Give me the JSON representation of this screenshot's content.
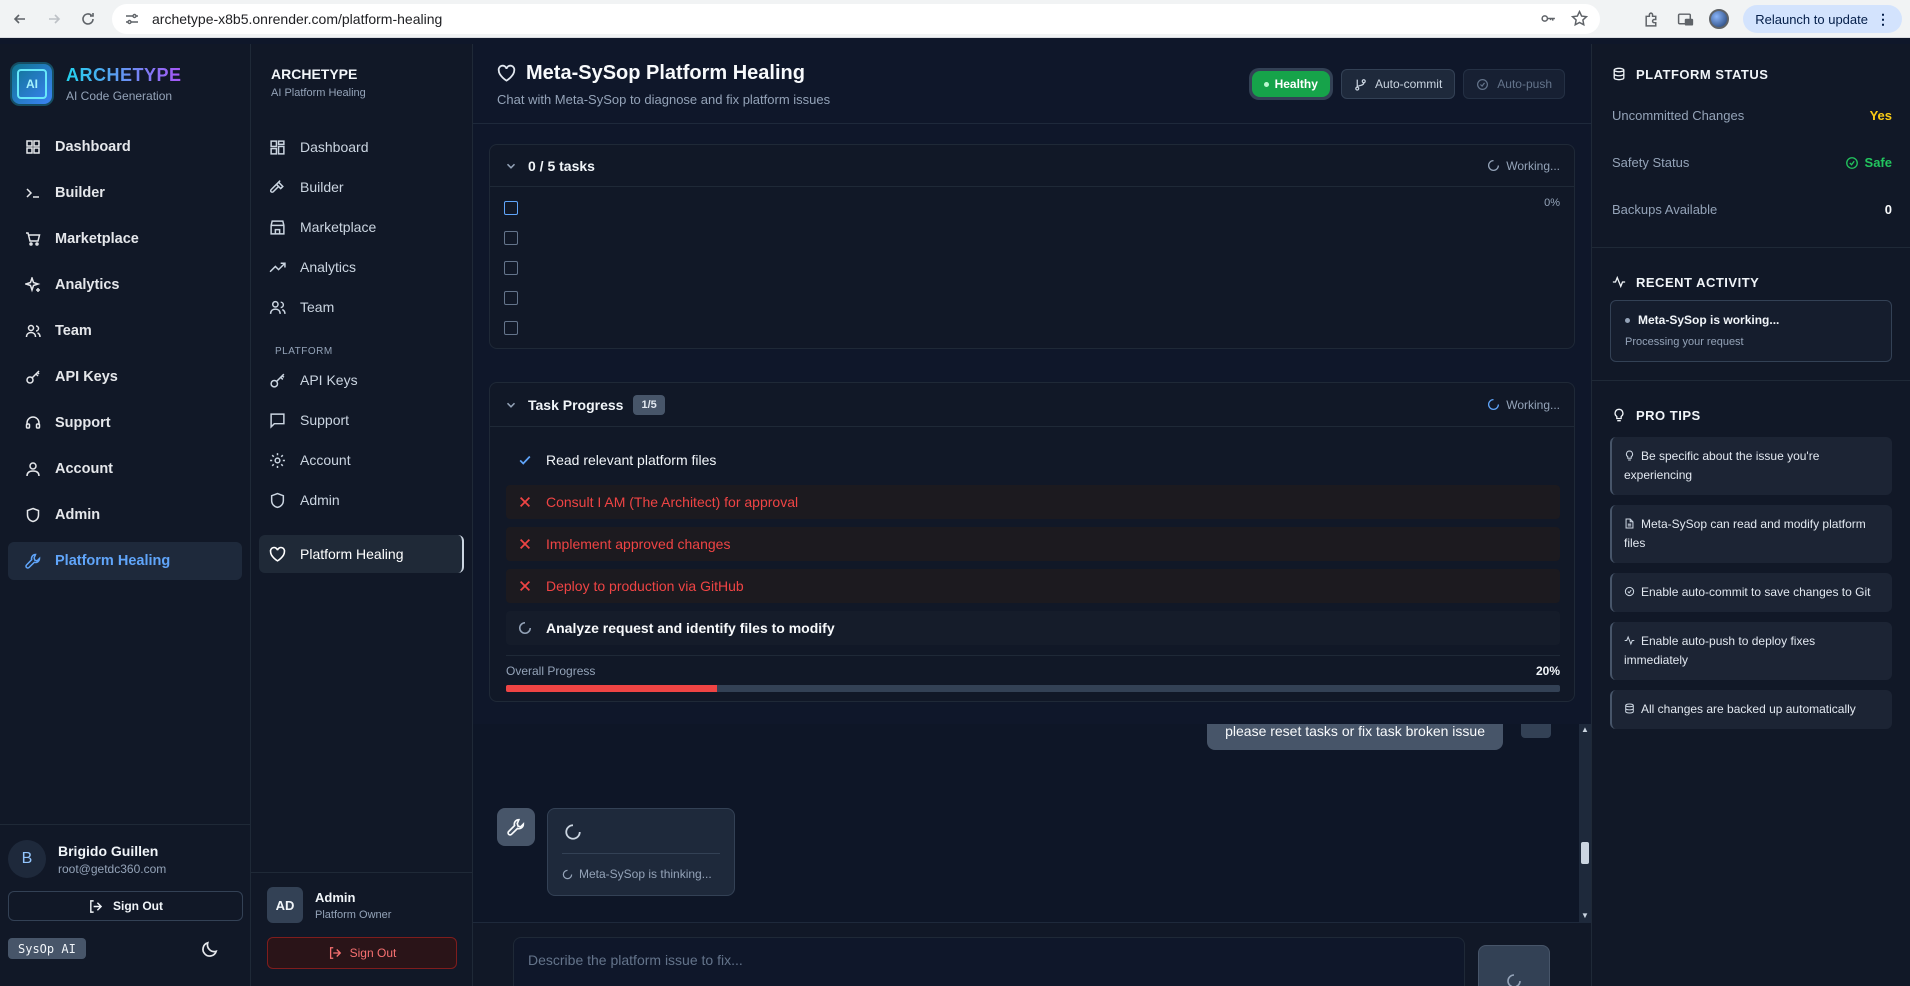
{
  "browser": {
    "url": "archetype-x8b5.onrender.com/platform-healing",
    "relaunch_label": "Relaunch to update"
  },
  "sidebar1": {
    "brand_title": "ARCHETYPE",
    "brand_sub": "AI Code Generation",
    "logo_text": "AI",
    "items": [
      {
        "label": "Dashboard",
        "icon": "grid-icon"
      },
      {
        "label": "Builder",
        "icon": "terminal-icon"
      },
      {
        "label": "Marketplace",
        "icon": "cart-icon"
      },
      {
        "label": "Analytics",
        "icon": "sparkle-icon"
      },
      {
        "label": "Team",
        "icon": "users-icon"
      },
      {
        "label": "API Keys",
        "icon": "key-icon"
      },
      {
        "label": "Support",
        "icon": "headset-icon"
      },
      {
        "label": "Account",
        "icon": "user-icon"
      },
      {
        "label": "Admin",
        "icon": "shield-icon"
      },
      {
        "label": "Platform Healing",
        "icon": "wrench-icon"
      }
    ],
    "user_initial": "B",
    "user_name": "Brigido Guillen",
    "user_email": "root@getdc360.com",
    "signout_label": "Sign Out",
    "sysop_badge": "SysOp AI"
  },
  "sidebar2": {
    "title": "ARCHETYPE",
    "subtitle": "AI Platform Healing",
    "items": [
      {
        "label": "Dashboard"
      },
      {
        "label": "Builder"
      },
      {
        "label": "Marketplace"
      },
      {
        "label": "Analytics"
      },
      {
        "label": "Team"
      }
    ],
    "section_label": "PLATFORM",
    "platform_items": [
      {
        "label": "API Keys"
      },
      {
        "label": "Support"
      },
      {
        "label": "Account"
      },
      {
        "label": "Admin"
      }
    ],
    "active_label": "Platform Healing",
    "user_initials": "AD",
    "user_name": "Admin",
    "user_role": "Platform Owner",
    "signout_label": "Sign Out"
  },
  "header": {
    "title": "Meta-SySop Platform Healing",
    "subtitle": "Chat with Meta-SySop to diagnose and fix platform issues",
    "healthy_label": "Healthy",
    "autocommit_label": "Auto-commit",
    "autopush_label": "Auto-push",
    "colors": {
      "healthy": "#16a34a"
    }
  },
  "tasks_card": {
    "title": "0 / 5 tasks",
    "status": "Working...",
    "percent_label": "0%",
    "checkbox_count": 5
  },
  "progress_card": {
    "title": "Task Progress",
    "badge": "1/5",
    "status": "Working...",
    "tasks": [
      {
        "label": "Read relevant platform files",
        "state": "done"
      },
      {
        "label": "Consult I AM (The Architect) for approval",
        "state": "failed"
      },
      {
        "label": "Implement approved changes",
        "state": "failed"
      },
      {
        "label": "Deploy to production via GitHub",
        "state": "failed"
      },
      {
        "label": "Analyze request and identify files to modify",
        "state": "running"
      }
    ],
    "overall_label": "Overall Progress",
    "overall_percent": "20%",
    "overall_fraction": 0.2,
    "colors": {
      "progress": "#ef4444",
      "failed": "#ef4444"
    }
  },
  "chat": {
    "user_message": "please reset tasks or fix task broken issue",
    "thinking_label": "Meta-SySop is thinking..."
  },
  "composer": {
    "placeholder": "Describe the platform issue to fix..."
  },
  "right_panel": {
    "status_title": "PLATFORM STATUS",
    "stats": [
      {
        "label": "Uncommitted Changes",
        "value": "Yes"
      },
      {
        "label": "Safety Status",
        "value": "Safe"
      },
      {
        "label": "Backups Available",
        "value": "0"
      }
    ],
    "activity_title": "RECENT ACTIVITY",
    "activity_item_title": "Meta-SySop is working...",
    "activity_item_sub": "Processing your request",
    "tips_title": "PRO TIPS",
    "tips": [
      {
        "text": "Be specific about the issue you're experiencing",
        "icon": "bulb-icon"
      },
      {
        "text": "Meta-SySop can read and modify platform files",
        "icon": "file-icon"
      },
      {
        "text": "Enable auto-commit to save changes to Git",
        "icon": "check-circle-icon"
      },
      {
        "text": "Enable auto-push to deploy fixes immediately",
        "icon": "activity-icon"
      },
      {
        "text": "All changes are backed up automatically",
        "icon": "database-icon"
      }
    ]
  }
}
